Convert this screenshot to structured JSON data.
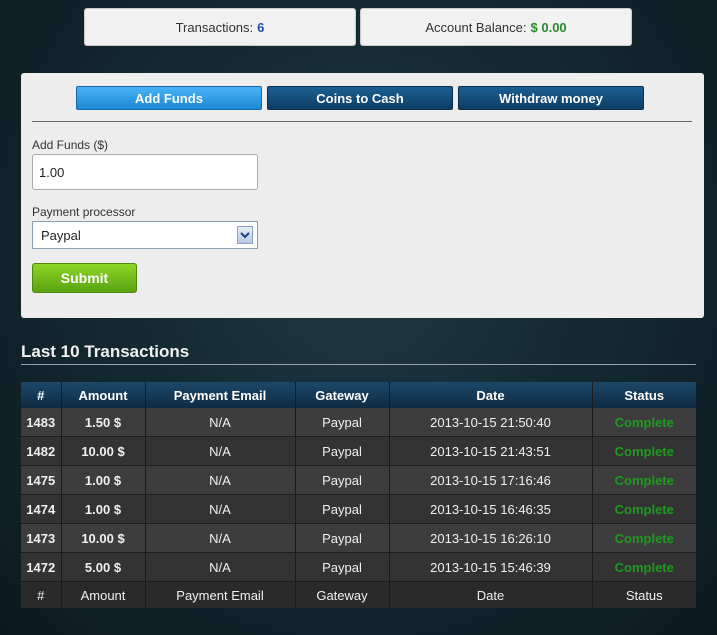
{
  "stats": {
    "transactions_label": "Transactions:",
    "transactions_value": "6",
    "balance_label": "Account Balance:",
    "balance_value": "$ 0.00"
  },
  "tabs": [
    {
      "label": "Add Funds",
      "active": true
    },
    {
      "label": "Coins to Cash",
      "active": false
    },
    {
      "label": "Withdraw money",
      "active": false
    }
  ],
  "form": {
    "amount_label": "Add Funds ($)",
    "amount_value": "1.00",
    "processor_label": "Payment processor",
    "processor_value": "Paypal",
    "submit_label": "Submit"
  },
  "transactions": {
    "title": "Last 10 Transactions",
    "columns": [
      "#",
      "Amount",
      "Payment Email",
      "Gateway",
      "Date",
      "Status"
    ],
    "rows": [
      {
        "id": "1483",
        "amount": "1.50 $",
        "email": "N/A",
        "gateway": "Paypal",
        "date": "2013-10-15 21:50:40",
        "status": "Complete"
      },
      {
        "id": "1482",
        "amount": "10.00 $",
        "email": "N/A",
        "gateway": "Paypal",
        "date": "2013-10-15 21:43:51",
        "status": "Complete"
      },
      {
        "id": "1475",
        "amount": "1.00 $",
        "email": "N/A",
        "gateway": "Paypal",
        "date": "2013-10-15 17:16:46",
        "status": "Complete"
      },
      {
        "id": "1474",
        "amount": "1.00 $",
        "email": "N/A",
        "gateway": "Paypal",
        "date": "2013-10-15 16:46:35",
        "status": "Complete"
      },
      {
        "id": "1473",
        "amount": "10.00 $",
        "email": "N/A",
        "gateway": "Paypal",
        "date": "2013-10-15 16:26:10",
        "status": "Complete"
      },
      {
        "id": "1472",
        "amount": "5.00 $",
        "email": "N/A",
        "gateway": "Paypal",
        "date": "2013-10-15 15:46:39",
        "status": "Complete"
      }
    ]
  },
  "colors": {
    "status_complete": "#1e9a1e",
    "tab_active": "#2b9be6",
    "tab_inactive": "#0f4a78",
    "submit": "#6fb81a"
  },
  "icons": {
    "select_arrow": "chevron-down-icon"
  }
}
